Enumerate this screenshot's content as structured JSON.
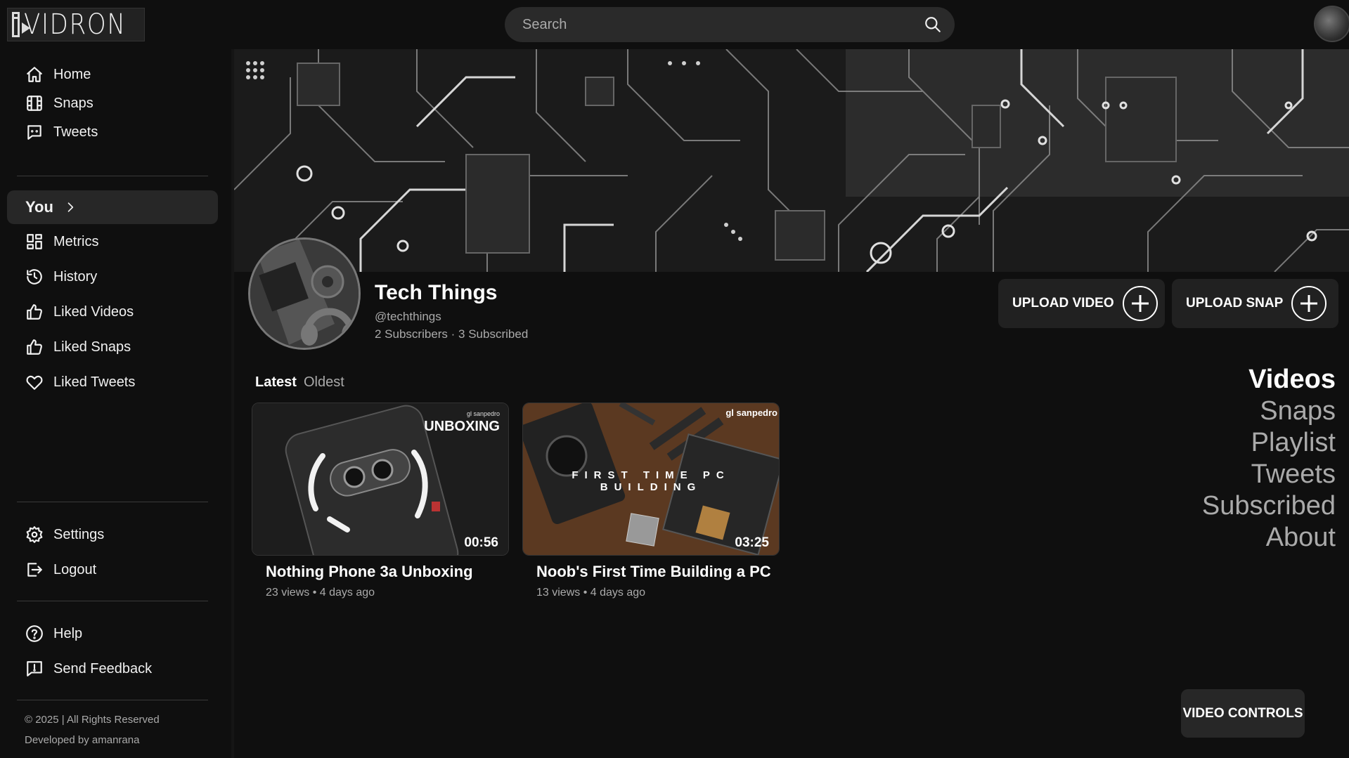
{
  "app": {
    "logo_text": "VIDRON"
  },
  "search": {
    "placeholder": "Search"
  },
  "sidebar": {
    "primary": [
      {
        "label": "Home",
        "icon": "home-icon"
      },
      {
        "label": "Snaps",
        "icon": "film-icon"
      },
      {
        "label": "Tweets",
        "icon": "chat-icon"
      }
    ],
    "you_label": "You",
    "you_items": [
      {
        "label": "Metrics",
        "icon": "dashboard-icon"
      },
      {
        "label": "History",
        "icon": "history-icon"
      },
      {
        "label": "Liked Videos",
        "icon": "thumb-up-icon"
      },
      {
        "label": "Liked Snaps",
        "icon": "thumb-up-icon"
      },
      {
        "label": "Liked Tweets",
        "icon": "heart-icon"
      }
    ],
    "account": [
      {
        "label": "Settings",
        "icon": "gear-icon"
      },
      {
        "label": "Logout",
        "icon": "logout-icon"
      }
    ],
    "support": [
      {
        "label": "Help",
        "icon": "help-icon"
      },
      {
        "label": "Send Feedback",
        "icon": "feedback-icon"
      }
    ],
    "footer": {
      "copyright": "© 2025 | All Rights Reserved",
      "developer": "Developed by amanrana"
    }
  },
  "channel": {
    "name": "Tech Things",
    "handle": "@techthings",
    "stats": "2 Subscribers · 3 Subscribed"
  },
  "actions": {
    "upload_video": "UPLOAD VIDEO",
    "upload_snap": "UPLOAD SNAP"
  },
  "sort": {
    "latest": "Latest",
    "oldest": "Oldest",
    "selected": "Latest"
  },
  "videos": [
    {
      "title": "Nothing Phone 3a Unboxing",
      "meta": "23 views • 4 days ago",
      "duration": "00:56",
      "overlay": "UNBOXING",
      "watermark": "gl sanpedro"
    },
    {
      "title": "Noob's First Time Building a PC",
      "meta": "13 views • 4 days ago",
      "duration": "03:25",
      "overlay": "FIRST TIME PC BUILDING",
      "watermark": "gl sanpedro"
    }
  ],
  "section_nav": [
    "Videos",
    "Snaps",
    "Playlist",
    "Tweets",
    "Subscribed",
    "About"
  ],
  "section_selected": "Videos",
  "video_controls_label": "VIDEO CONTROLS",
  "colors": {
    "background": "#0f0f0f",
    "panel": "#212121",
    "active_nav": "#272727",
    "muted_text": "#aaaaaa"
  }
}
